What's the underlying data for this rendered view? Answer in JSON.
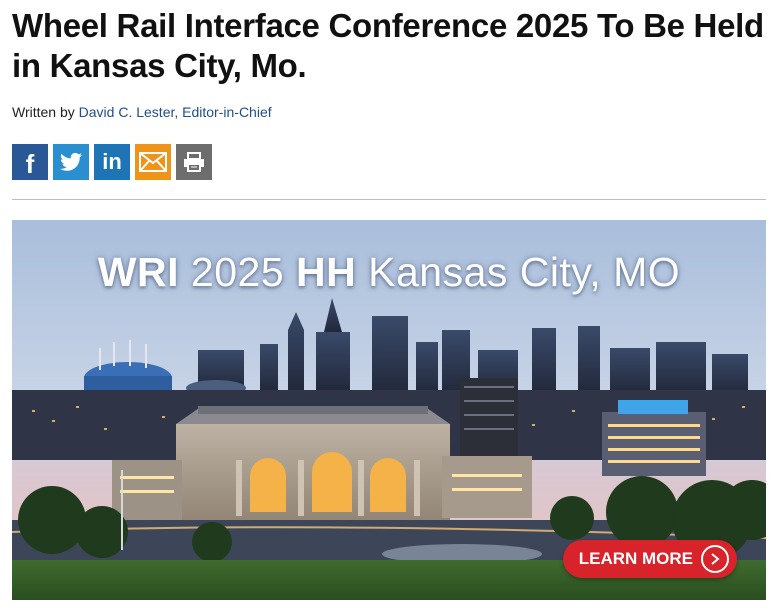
{
  "article": {
    "title": "Wheel Rail Interface Conference 2025 To Be Held in Kansas City, Mo.",
    "byline_prefix": "Written by",
    "author": "David C. Lester, Editor-in-Chief"
  },
  "share": {
    "facebook_glyph": "f",
    "linkedin_glyph": "in",
    "icons": [
      "facebook-icon",
      "twitter-icon",
      "linkedin-icon",
      "email-icon",
      "print-icon"
    ],
    "colors": {
      "facebook": "#2a5795",
      "twitter": "#2b8fcf",
      "linkedin": "#1e74b4",
      "email": "#ef9418",
      "print": "#6d6d6d"
    }
  },
  "banner": {
    "headline_bold_1": "WRI",
    "headline_mid": "2025",
    "headline_bold_2": "HH",
    "headline_rest": "Kansas City, MO",
    "cta_label": "LEARN MORE",
    "cta_color": "#d8232a"
  }
}
